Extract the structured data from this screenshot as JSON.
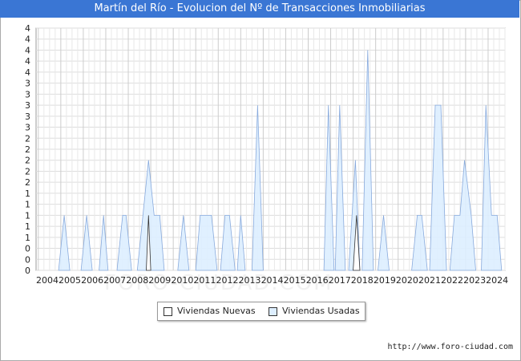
{
  "chart_data": {
    "type": "area",
    "title": "Martín del Río - Evolucion del Nº de Transacciones Inmobiliarias",
    "xlabel": "",
    "ylabel": "",
    "x_ticks": [
      "2004",
      "2005",
      "2006",
      "2007",
      "2008",
      "2009",
      "2010",
      "2011",
      "2012",
      "2013",
      "2014",
      "2015",
      "2016",
      "2017",
      "2018",
      "2019",
      "2020",
      "2021",
      "2022",
      "2023",
      "2024"
    ],
    "y_tick_labels": [
      "0",
      "0",
      "0",
      "1",
      "1",
      "1",
      "1",
      "1",
      "2",
      "2",
      "2",
      "2",
      "2",
      "3",
      "3",
      "3",
      "3",
      "3",
      "4",
      "4",
      "4",
      "4",
      "4"
    ],
    "ylim": [
      0,
      4.4
    ],
    "grid": true,
    "legend_position": "bottom",
    "source": "http://www.foro-ciudad.com",
    "watermark": "FORO-CIUDAD.COM",
    "series": [
      {
        "name": "Viviendas Nuevas",
        "color": "#ffffff",
        "points": [
          [
            2008.9,
            0
          ],
          [
            2009.0,
            1
          ],
          [
            2009.1,
            0
          ],
          [
            2018.1,
            0
          ],
          [
            2018.25,
            1
          ],
          [
            2018.4,
            0
          ]
        ]
      },
      {
        "name": "Viviendas Usadas",
        "color": "#ddeeff",
        "points": [
          [
            2005.0,
            0
          ],
          [
            2005.25,
            1
          ],
          [
            2005.5,
            0
          ],
          [
            2006.0,
            0
          ],
          [
            2006.25,
            1
          ],
          [
            2006.5,
            0
          ],
          [
            2006.8,
            0
          ],
          [
            2007.0,
            1
          ],
          [
            2007.2,
            0
          ],
          [
            2007.6,
            0
          ],
          [
            2007.85,
            1
          ],
          [
            2008.0,
            1
          ],
          [
            2008.25,
            0
          ],
          [
            2008.5,
            0
          ],
          [
            2008.75,
            1
          ],
          [
            2009.0,
            2
          ],
          [
            2009.25,
            1
          ],
          [
            2009.5,
            1
          ],
          [
            2009.7,
            0
          ],
          [
            2010.3,
            0
          ],
          [
            2010.55,
            1
          ],
          [
            2010.8,
            0
          ],
          [
            2011.1,
            0
          ],
          [
            2011.3,
            1
          ],
          [
            2011.8,
            1
          ],
          [
            2012.05,
            0
          ],
          [
            2012.2,
            0
          ],
          [
            2012.4,
            1
          ],
          [
            2012.6,
            1
          ],
          [
            2012.85,
            0
          ],
          [
            2012.95,
            0
          ],
          [
            2013.1,
            1
          ],
          [
            2013.3,
            0
          ],
          [
            2013.6,
            0
          ],
          [
            2013.85,
            3
          ],
          [
            2014.1,
            0
          ],
          [
            2016.8,
            0
          ],
          [
            2017.0,
            3
          ],
          [
            2017.25,
            0
          ],
          [
            2017.3,
            0
          ],
          [
            2017.5,
            3
          ],
          [
            2017.75,
            0
          ],
          [
            2017.9,
            0
          ],
          [
            2018.2,
            2
          ],
          [
            2018.4,
            0
          ],
          [
            2018.5,
            0
          ],
          [
            2018.75,
            4
          ],
          [
            2019.0,
            0
          ],
          [
            2019.2,
            0
          ],
          [
            2019.45,
            1
          ],
          [
            2019.7,
            0
          ],
          [
            2020.7,
            0
          ],
          [
            2020.95,
            1
          ],
          [
            2021.15,
            1
          ],
          [
            2021.4,
            0
          ],
          [
            2021.5,
            0
          ],
          [
            2021.75,
            3
          ],
          [
            2022.0,
            3
          ],
          [
            2022.25,
            0
          ],
          [
            2022.4,
            0
          ],
          [
            2022.6,
            1
          ],
          [
            2022.85,
            1
          ],
          [
            2023.05,
            2
          ],
          [
            2023.35,
            1
          ],
          [
            2023.55,
            0
          ],
          [
            2023.8,
            0
          ],
          [
            2024.0,
            3
          ],
          [
            2024.25,
            1
          ],
          [
            2024.5,
            1
          ],
          [
            2024.7,
            0
          ]
        ]
      }
    ]
  }
}
